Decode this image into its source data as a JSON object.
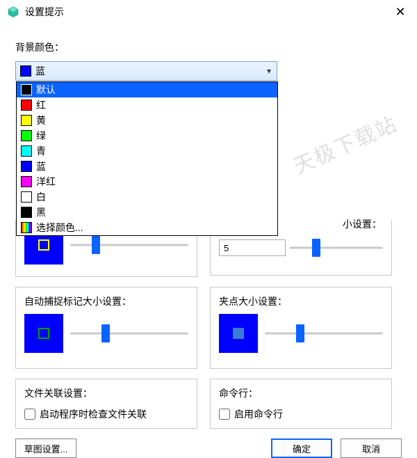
{
  "window": {
    "title": "设置提示"
  },
  "watermark": "天极下载站",
  "background_color": {
    "label": "背景颜色：",
    "selected": {
      "name": "蓝",
      "color": "#0000ff"
    },
    "options": [
      {
        "name": "默认",
        "color": "#000000"
      },
      {
        "name": "红",
        "color": "#ff0000"
      },
      {
        "name": "黄",
        "color": "#ffff00"
      },
      {
        "name": "绿",
        "color": "#00ff00"
      },
      {
        "name": "青",
        "color": "#00ffff"
      },
      {
        "name": "蓝",
        "color": "#0000ff"
      },
      {
        "name": "洋红",
        "color": "#ff00ff"
      },
      {
        "name": "白",
        "color": "#ffffff"
      },
      {
        "name": "黑",
        "color": "#000000"
      },
      {
        "name": "选择颜色...",
        "color": "rainbow"
      }
    ]
  },
  "panels": {
    "left_upper": {
      "preview_outline": "#ffff00",
      "thumb_pct": 22
    },
    "right_upper": {
      "label_fragment": "小设置：",
      "value": "5",
      "thumb_pct": 28
    },
    "auto_capture": {
      "label": "自动捕捉标记大小设置：",
      "preview_outline": "#00a000",
      "thumb_pct": 30
    },
    "grip": {
      "label": "夹点大小设置：",
      "preview_fill": "#3a7bd5",
      "thumb_pct": 30
    }
  },
  "file_assoc": {
    "label": "文件关联设置：",
    "checkbox": "启动程序时检查文件关联"
  },
  "cmdline": {
    "label": "命令行：",
    "checkbox": "启用命令行"
  },
  "buttons": {
    "sketch": "草图设置...",
    "ok": "确定",
    "cancel": "取消"
  }
}
